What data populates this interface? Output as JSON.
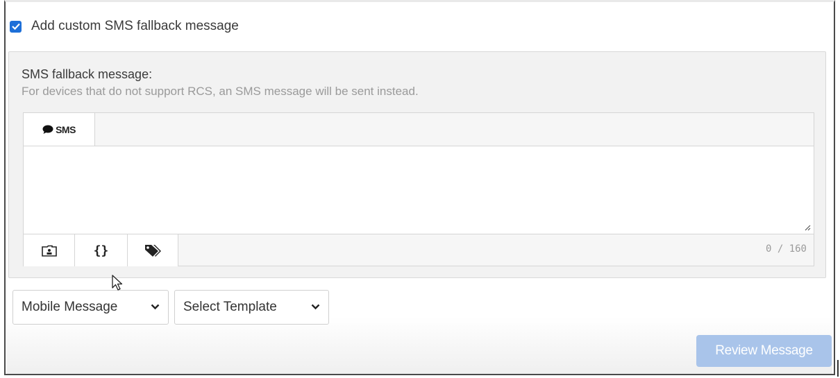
{
  "fallback": {
    "checkbox_label": "Add custom SMS fallback message",
    "checked": true,
    "panel_title": "SMS fallback message:",
    "panel_hint": "For devices that do not support RCS, an SMS message will be sent instead."
  },
  "editor": {
    "tab_label": "SMS",
    "message_value": "",
    "tools": {
      "contact_icon": "contact-card-icon",
      "variable_label": "{}",
      "tag_icon": "tags-icon"
    },
    "char_counter": "0 / 160"
  },
  "footer": {
    "message_type_select": "Mobile Message",
    "template_select": "Select Template",
    "review_button": "Review Message"
  },
  "colors": {
    "accent": "#1d6fd8",
    "review_button_disabled": "#a9c4ea",
    "panel_background": "#f2f2f2"
  }
}
